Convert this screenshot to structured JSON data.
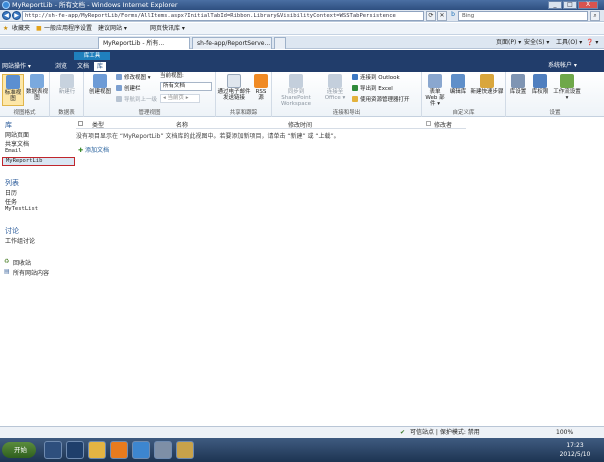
{
  "window": {
    "title": "MyReportLib - 所有文档 - Windows Internet Explorer",
    "minimize": "_",
    "maximize": "□",
    "close": "X"
  },
  "address": {
    "url": "http://sh-fe-app/MyReportLib/Forms/AllItems.aspx?InitialTabId=Ribbon.Library&VisibilityContext=WSSTabPersistence",
    "search_placeholder": "Bing"
  },
  "favorites": {
    "label": "收藏夹",
    "items": [
      "一般应用程序设置",
      "建议网站 ▾",
      "网页快讯库 ▾"
    ]
  },
  "tabs": [
    {
      "label": "MyReportLib - 所有..."
    },
    {
      "label": "sh-fe-app/ReportServe..."
    }
  ],
  "commands": {
    "page": "页面(P) ▾",
    "safety": "安全(S) ▾",
    "tools": "工具(O) ▾",
    "help": "❓ ▾"
  },
  "sharepoint": {
    "site_actions": "网站操作 ▾",
    "browse": "浏览",
    "tools_group": "库工具",
    "tab_documents": "文档",
    "tab_library": "库",
    "account": "系统帐户 ▾"
  },
  "ribbon": {
    "groups": [
      "视图格式",
      "数据表",
      "管理视图",
      "共享和跟踪",
      "连接和导出",
      "自定义库",
      "设置"
    ],
    "standard_view": "标准视图",
    "datasheet_view": "数据表视图",
    "new_row": "新建行",
    "create_view": "创建视图",
    "modify_view": "修改视图 ▾",
    "create_column": "创建栏",
    "navigate_up": "导航到上一级",
    "current_view_label": "当前视图:",
    "current_view": "所有文档",
    "current_page": "◂ 当前页 ▸",
    "email_link": "通过电子邮件发送链接",
    "rss": "RSS 源",
    "sync_workspace": "同步到 SharePoint Workspace",
    "connect_office": "连接至 Office ▾",
    "connect_outlook": "连接到 Outlook",
    "export_excel": "导出到 Excel",
    "open_explorer": "使用资源管理器打开",
    "form_webparts": "表单 Web 部件 ▾",
    "edit_library": "编辑库",
    "new_quick_step": "新建快速步骤",
    "library_settings": "库设置",
    "library_permissions": "库权限",
    "workflow_settings": "工作流设置 ▾"
  },
  "leftnav": {
    "libraries_header": "库",
    "libraries": [
      "网站页面",
      "共享文档",
      "Email",
      "MyReportLib"
    ],
    "lists_header": "列表",
    "lists": [
      "日历",
      "任务",
      "MyTestList"
    ],
    "discussions_header": "讨论",
    "discussions": [
      "工作组讨论"
    ],
    "recycle_bin": "回收站",
    "all_content": "所有网站内容"
  },
  "content": {
    "col_type": "类型",
    "col_name": "名称",
    "col_modified": "修改时间",
    "col_modified_by": "修改者",
    "empty_message": "没有项目显示在 “MyReportLib” 文档库的此视图中。若要添加新项目，请单击 “新建” 或 “上载”。",
    "add_document": "添加文档"
  },
  "status": {
    "zone": "可信站点 | 保护模式: 禁用",
    "zoom": "100%"
  },
  "taskbar": {
    "start": "开始",
    "time": "17:23",
    "date": "2012/5/10"
  }
}
